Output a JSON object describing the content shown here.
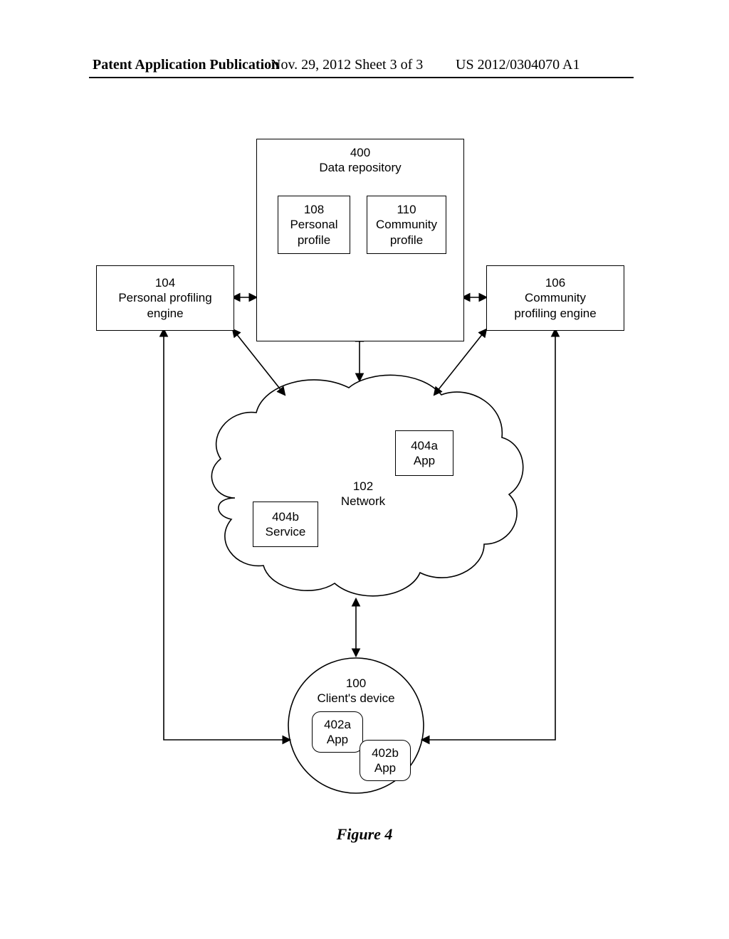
{
  "header": {
    "left": "Patent Application Publication",
    "center": "Nov. 29, 2012  Sheet 3 of 3",
    "right": "US 2012/0304070 A1"
  },
  "repo": {
    "num": "400",
    "label": "Data repository"
  },
  "personalProfile": {
    "num": "108",
    "label1": "Personal",
    "label2": "profile"
  },
  "communityProfile": {
    "num": "110",
    "label1": "Community",
    "label2": "profile"
  },
  "personalEngine": {
    "num": "104",
    "label1": "Personal profiling",
    "label2": "engine"
  },
  "communityEngine": {
    "num": "106",
    "label1": "Community",
    "label2": "profiling engine"
  },
  "network": {
    "num": "102",
    "label": "Network"
  },
  "appA": {
    "num": "404a",
    "label": "App"
  },
  "serviceB": {
    "num": "404b",
    "label": "Service"
  },
  "client": {
    "num": "100",
    "label": "Client's device"
  },
  "clientAppA": {
    "num": "402a",
    "label": "App"
  },
  "clientAppB": {
    "num": "402b",
    "label": "App"
  },
  "figure": "Figure 4"
}
